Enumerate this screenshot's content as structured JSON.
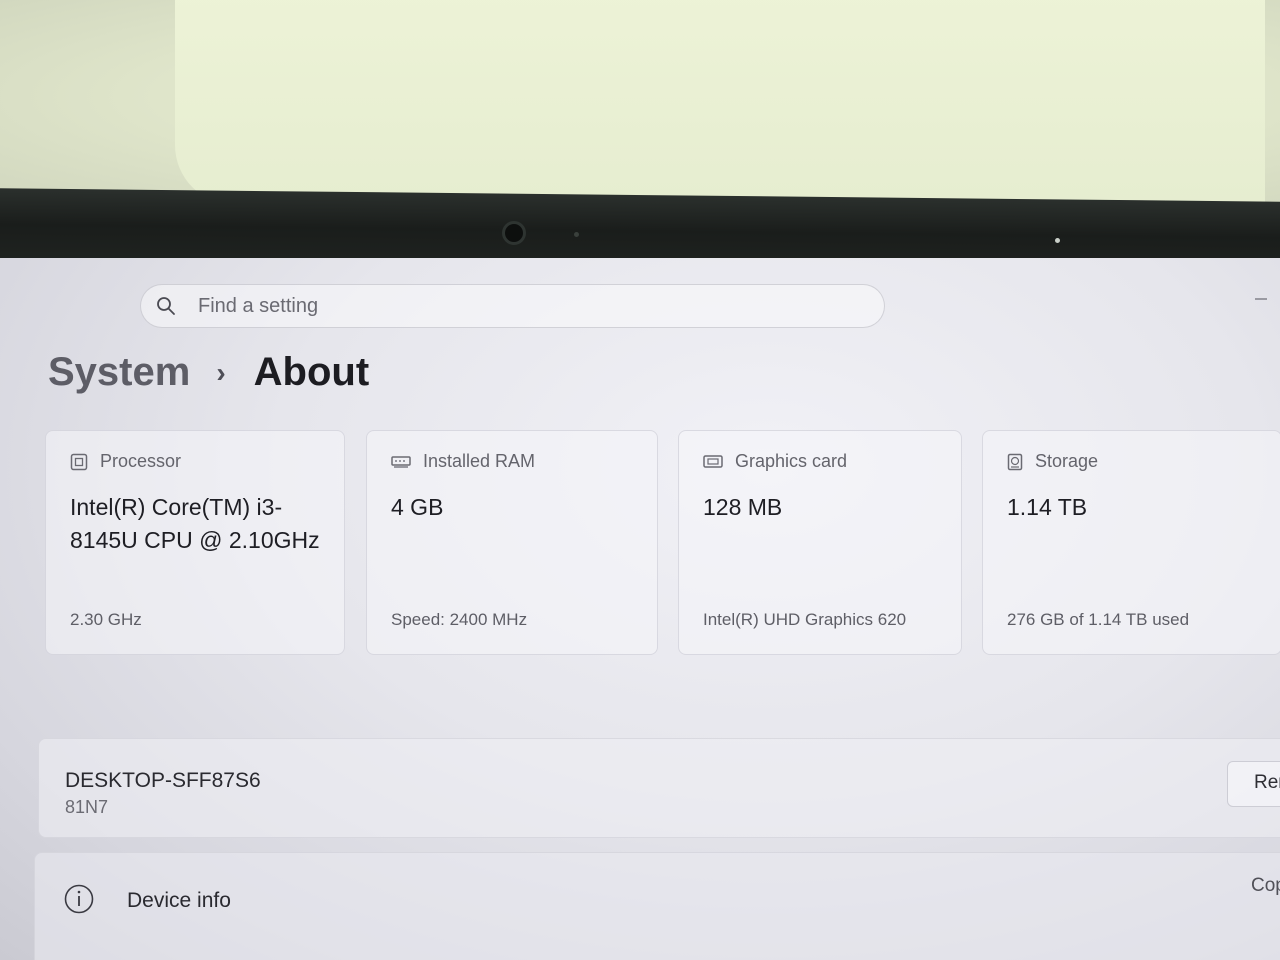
{
  "search": {
    "placeholder": "Find a setting"
  },
  "breadcrumb": {
    "parent": "System",
    "separator": "›",
    "current": "About"
  },
  "specs": [
    {
      "icon": "processor-icon",
      "label": "Processor",
      "value": "Intel(R) Core(TM) i3-8145U CPU @ 2.10GHz",
      "detail": "2.30 GHz"
    },
    {
      "icon": "ram-icon",
      "label": "Installed RAM",
      "value": "4 GB",
      "detail": "Speed: 2400 MHz"
    },
    {
      "icon": "graphics-card-icon",
      "label": "Graphics card",
      "value": "128 MB",
      "detail": "Intel(R) UHD Graphics 620"
    },
    {
      "icon": "storage-icon",
      "label": "Storage",
      "value": "1.14 TB",
      "detail": "276 GB of 1.14 TB used"
    }
  ],
  "device": {
    "name": "DESKTOP-SFF87S6",
    "model": "81N7",
    "rename_label": "Rename"
  },
  "device_info": {
    "label": "Device info",
    "copy_label": "Copy"
  },
  "colors": {
    "screen_bg": "#e6e6ec",
    "text_primary": "#1e1e24",
    "text_secondary": "#64646c",
    "bezel": "#1f2321"
  }
}
